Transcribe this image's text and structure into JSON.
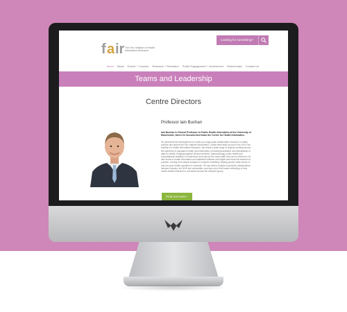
{
  "site": {
    "logo_text": "fair",
    "logo_subtitle": "The Farr Institute of Health Informatics Research"
  },
  "search": {
    "label": "Looking for something?"
  },
  "nav": {
    "items": [
      "About",
      "News",
      "Events + Courses",
      "Research + Education",
      "Public Engagement + Involvement",
      "Partnerships",
      "Contact Us"
    ]
  },
  "banner": {
    "title": "Teams and Leadership"
  },
  "section": {
    "title": "Centre Directors"
  },
  "profile": {
    "name": "Professor Iain Buchan",
    "bold_text": "Iain Buchan is Clinical Professor in Public Health Informatics at the University of Manchester, where he founded and leads the Centre for Health Informatics.",
    "body_text": "He pioneered the development of in-silico (or large-scale collaborative research in health science and directs the Farr Institute Manchester. Centre sees itself as part of the UK's Farr Institute for Health Informatics Research. Iain leads a wide range of projects working across the spectrum of population health and informatics, promoting translation and stewardship of data for health, bringing together clinical medicine, pharmacology, public health and computational statistics to understand and improve the way health and care is delivered. He also works in health informatics and statistical software and digital tools that link research to practice, moving from simple analysis to complex modelling, helping people make sense of and act upon health questions in research. He has driven multiple successful collaborations between industry, the NHS and universities, and lays out a third based rethinking of how health-related research is conducted across the research group.",
    "button_label": "Find out more ›"
  },
  "colors": {
    "backdrop": "#cf86b8",
    "accent": "#c980ba",
    "button": "#8bb63e"
  },
  "icons": [
    "search-icon",
    "monitor-brand-logo"
  ]
}
